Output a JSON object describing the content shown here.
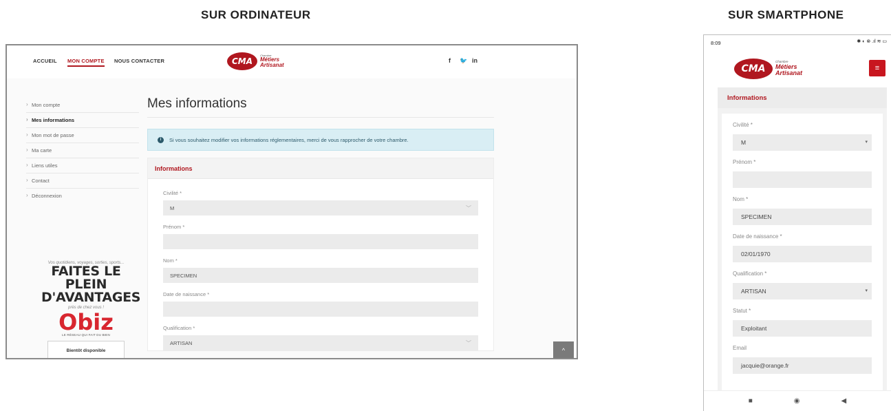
{
  "headings": {
    "desktop": "SUR ORDINATEUR",
    "mobile": "SUR SMARTPHONE"
  },
  "desktop": {
    "nav": [
      {
        "label": "ACCUEIL"
      },
      {
        "label": "MON COMPTE"
      },
      {
        "label": "NOUS CONTACTER"
      }
    ],
    "logo": {
      "mark": "CMA",
      "line1": "Chambre",
      "line2": "Métiers",
      "line3": "Artisanat"
    },
    "social": {
      "facebook": "f",
      "twitter": "🐦",
      "linkedin": "in"
    },
    "sidebar": [
      {
        "label": "Mon compte"
      },
      {
        "label": "Mes informations"
      },
      {
        "label": "Mon mot de passe"
      },
      {
        "label": "Ma carte"
      },
      {
        "label": "Liens utiles"
      },
      {
        "label": "Contact"
      },
      {
        "label": "Déconnexion"
      }
    ],
    "promo": {
      "tagline": "Vos quotidiens, voyages, sorties, sports...",
      "title1": "FAITES LE PLEIN",
      "title2": "D'AVANTAGES",
      "sub": "près de chez vous !",
      "brand": "Obiz",
      "brand_tag": "LE RÉSEAU QUI FAIT DU BIEN",
      "button": "Bientôt disponible"
    },
    "page_title": "Mes informations",
    "info_message": "Si vous souhaitez modifier vos informations réglementaires, merci de vous rapprocher de votre chambre.",
    "card_title": "Informations",
    "fields": [
      {
        "label": "Civilité *",
        "value": "M"
      },
      {
        "label": "Prénom *",
        "value": ""
      },
      {
        "label": "Nom *",
        "value": "SPECIMEN"
      },
      {
        "label": "Date de naissance *",
        "value": ""
      },
      {
        "label": "Qualification *",
        "value": "ARTISAN"
      }
    ],
    "scroll_top": "^"
  },
  "mobile": {
    "status_time": "8:09",
    "status_icons": "✱ ◐ ⊗ .ıl ≋ ▭",
    "menu": "≡",
    "card_title": "Informations",
    "fields": [
      {
        "label": "Civilité *",
        "value": "M"
      },
      {
        "label": "Prénom *",
        "value": ""
      },
      {
        "label": "Nom *",
        "value": "SPECIMEN"
      },
      {
        "label": "Date de naissance *",
        "value": "02/01/1970"
      },
      {
        "label": "Qualification *",
        "value": "ARTISAN"
      },
      {
        "label": "Statut *",
        "value": "Exploitant"
      },
      {
        "label": "Email",
        "value": "jacquie@orange.fr"
      }
    ],
    "nav_buttons": {
      "recent": "■",
      "home": "◉",
      "back": "◀"
    }
  },
  "colors": {
    "brand_red": "#b0171f",
    "info_bg": "#d9eef4"
  }
}
